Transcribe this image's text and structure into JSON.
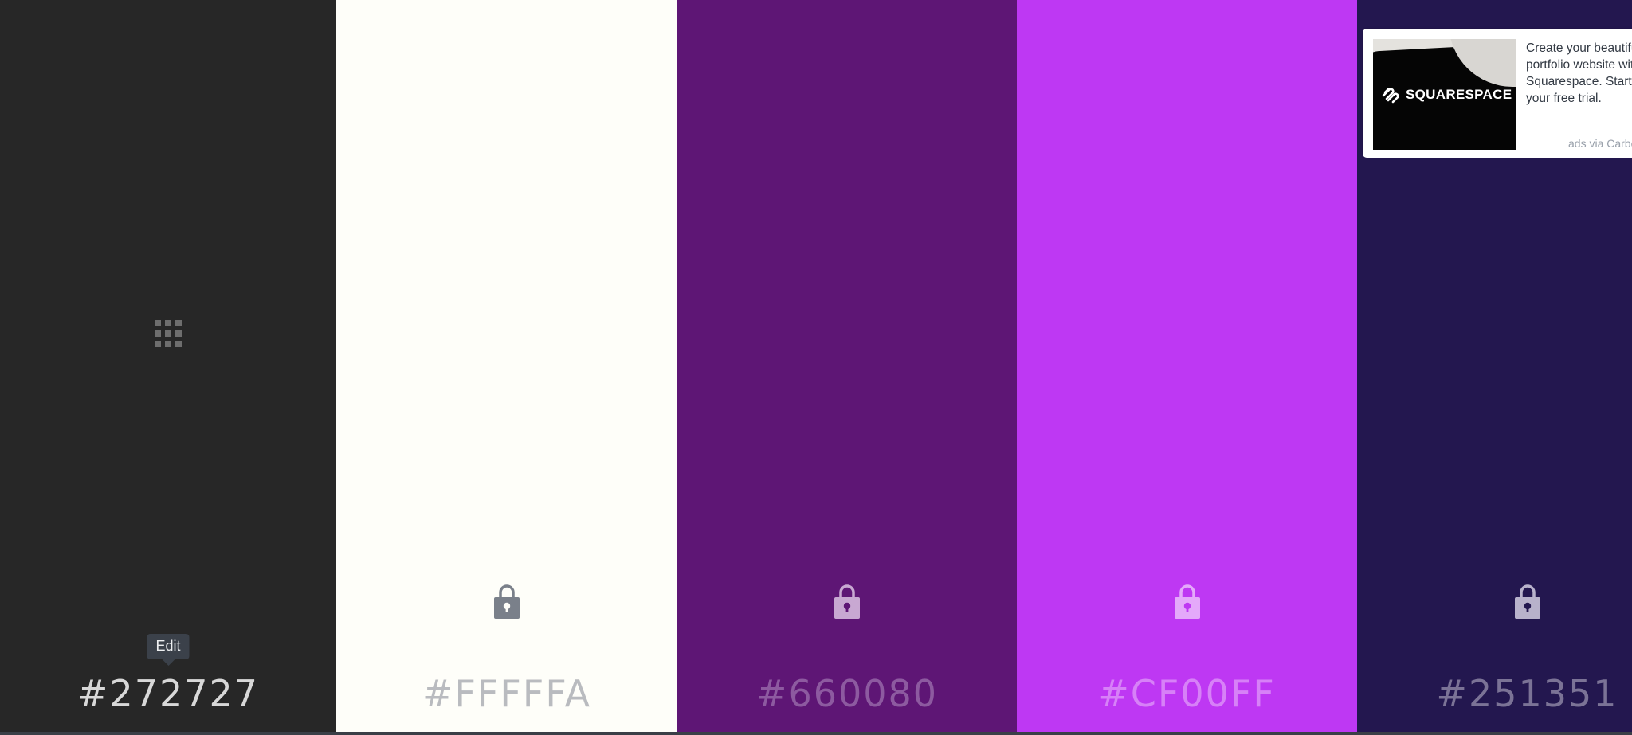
{
  "swatches": [
    {
      "hex": "#272727",
      "bg": "#272727",
      "text_color": "#d8d8d8",
      "icon": "grid-icon",
      "icon_color": "#6e6e6e",
      "tooltip": "Edit"
    },
    {
      "hex": "#FFFFFA",
      "bg": "#FEFEF9",
      "text_color": "#b9bbbf",
      "icon": "lock-icon",
      "icon_color": "#7a808a"
    },
    {
      "hex": "#660080",
      "bg": "#5E1675",
      "text_color": "#8d5aa0",
      "icon": "lock-icon",
      "icon_color": "#c8a8d2"
    },
    {
      "hex": "#CF00FF",
      "bg": "#BE38F3",
      "text_color": "#d781f7",
      "icon": "lock-icon",
      "icon_color": "#e4a9fa"
    },
    {
      "hex": "#251351",
      "bg": "#23174F",
      "text_color": "#7b7396",
      "icon": "lock-icon",
      "icon_color": "#b8b2cb"
    }
  ],
  "ad": {
    "brand": "SQUARESPACE",
    "text": "Create your beautiful portfolio website with Squarespace. Start your free trial.",
    "via": "ads via Carbon"
  }
}
